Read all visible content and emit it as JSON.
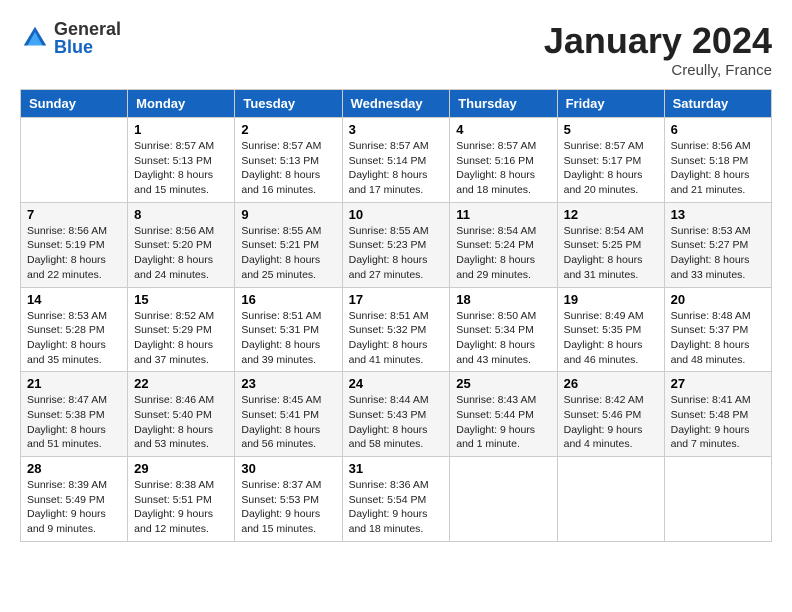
{
  "logo": {
    "general": "General",
    "blue": "Blue"
  },
  "title": "January 2024",
  "location": "Creully, France",
  "days_of_week": [
    "Sunday",
    "Monday",
    "Tuesday",
    "Wednesday",
    "Thursday",
    "Friday",
    "Saturday"
  ],
  "weeks": [
    [
      {
        "day": "",
        "sunrise": "",
        "sunset": "",
        "daylight": ""
      },
      {
        "day": "1",
        "sunrise": "Sunrise: 8:57 AM",
        "sunset": "Sunset: 5:13 PM",
        "daylight": "Daylight: 8 hours and 15 minutes."
      },
      {
        "day": "2",
        "sunrise": "Sunrise: 8:57 AM",
        "sunset": "Sunset: 5:13 PM",
        "daylight": "Daylight: 8 hours and 16 minutes."
      },
      {
        "day": "3",
        "sunrise": "Sunrise: 8:57 AM",
        "sunset": "Sunset: 5:14 PM",
        "daylight": "Daylight: 8 hours and 17 minutes."
      },
      {
        "day": "4",
        "sunrise": "Sunrise: 8:57 AM",
        "sunset": "Sunset: 5:16 PM",
        "daylight": "Daylight: 8 hours and 18 minutes."
      },
      {
        "day": "5",
        "sunrise": "Sunrise: 8:57 AM",
        "sunset": "Sunset: 5:17 PM",
        "daylight": "Daylight: 8 hours and 20 minutes."
      },
      {
        "day": "6",
        "sunrise": "Sunrise: 8:56 AM",
        "sunset": "Sunset: 5:18 PM",
        "daylight": "Daylight: 8 hours and 21 minutes."
      }
    ],
    [
      {
        "day": "7",
        "sunrise": "Sunrise: 8:56 AM",
        "sunset": "Sunset: 5:19 PM",
        "daylight": "Daylight: 8 hours and 22 minutes."
      },
      {
        "day": "8",
        "sunrise": "Sunrise: 8:56 AM",
        "sunset": "Sunset: 5:20 PM",
        "daylight": "Daylight: 8 hours and 24 minutes."
      },
      {
        "day": "9",
        "sunrise": "Sunrise: 8:55 AM",
        "sunset": "Sunset: 5:21 PM",
        "daylight": "Daylight: 8 hours and 25 minutes."
      },
      {
        "day": "10",
        "sunrise": "Sunrise: 8:55 AM",
        "sunset": "Sunset: 5:23 PM",
        "daylight": "Daylight: 8 hours and 27 minutes."
      },
      {
        "day": "11",
        "sunrise": "Sunrise: 8:54 AM",
        "sunset": "Sunset: 5:24 PM",
        "daylight": "Daylight: 8 hours and 29 minutes."
      },
      {
        "day": "12",
        "sunrise": "Sunrise: 8:54 AM",
        "sunset": "Sunset: 5:25 PM",
        "daylight": "Daylight: 8 hours and 31 minutes."
      },
      {
        "day": "13",
        "sunrise": "Sunrise: 8:53 AM",
        "sunset": "Sunset: 5:27 PM",
        "daylight": "Daylight: 8 hours and 33 minutes."
      }
    ],
    [
      {
        "day": "14",
        "sunrise": "Sunrise: 8:53 AM",
        "sunset": "Sunset: 5:28 PM",
        "daylight": "Daylight: 8 hours and 35 minutes."
      },
      {
        "day": "15",
        "sunrise": "Sunrise: 8:52 AM",
        "sunset": "Sunset: 5:29 PM",
        "daylight": "Daylight: 8 hours and 37 minutes."
      },
      {
        "day": "16",
        "sunrise": "Sunrise: 8:51 AM",
        "sunset": "Sunset: 5:31 PM",
        "daylight": "Daylight: 8 hours and 39 minutes."
      },
      {
        "day": "17",
        "sunrise": "Sunrise: 8:51 AM",
        "sunset": "Sunset: 5:32 PM",
        "daylight": "Daylight: 8 hours and 41 minutes."
      },
      {
        "day": "18",
        "sunrise": "Sunrise: 8:50 AM",
        "sunset": "Sunset: 5:34 PM",
        "daylight": "Daylight: 8 hours and 43 minutes."
      },
      {
        "day": "19",
        "sunrise": "Sunrise: 8:49 AM",
        "sunset": "Sunset: 5:35 PM",
        "daylight": "Daylight: 8 hours and 46 minutes."
      },
      {
        "day": "20",
        "sunrise": "Sunrise: 8:48 AM",
        "sunset": "Sunset: 5:37 PM",
        "daylight": "Daylight: 8 hours and 48 minutes."
      }
    ],
    [
      {
        "day": "21",
        "sunrise": "Sunrise: 8:47 AM",
        "sunset": "Sunset: 5:38 PM",
        "daylight": "Daylight: 8 hours and 51 minutes."
      },
      {
        "day": "22",
        "sunrise": "Sunrise: 8:46 AM",
        "sunset": "Sunset: 5:40 PM",
        "daylight": "Daylight: 8 hours and 53 minutes."
      },
      {
        "day": "23",
        "sunrise": "Sunrise: 8:45 AM",
        "sunset": "Sunset: 5:41 PM",
        "daylight": "Daylight: 8 hours and 56 minutes."
      },
      {
        "day": "24",
        "sunrise": "Sunrise: 8:44 AM",
        "sunset": "Sunset: 5:43 PM",
        "daylight": "Daylight: 8 hours and 58 minutes."
      },
      {
        "day": "25",
        "sunrise": "Sunrise: 8:43 AM",
        "sunset": "Sunset: 5:44 PM",
        "daylight": "Daylight: 9 hours and 1 minute."
      },
      {
        "day": "26",
        "sunrise": "Sunrise: 8:42 AM",
        "sunset": "Sunset: 5:46 PM",
        "daylight": "Daylight: 9 hours and 4 minutes."
      },
      {
        "day": "27",
        "sunrise": "Sunrise: 8:41 AM",
        "sunset": "Sunset: 5:48 PM",
        "daylight": "Daylight: 9 hours and 7 minutes."
      }
    ],
    [
      {
        "day": "28",
        "sunrise": "Sunrise: 8:39 AM",
        "sunset": "Sunset: 5:49 PM",
        "daylight": "Daylight: 9 hours and 9 minutes."
      },
      {
        "day": "29",
        "sunrise": "Sunrise: 8:38 AM",
        "sunset": "Sunset: 5:51 PM",
        "daylight": "Daylight: 9 hours and 12 minutes."
      },
      {
        "day": "30",
        "sunrise": "Sunrise: 8:37 AM",
        "sunset": "Sunset: 5:53 PM",
        "daylight": "Daylight: 9 hours and 15 minutes."
      },
      {
        "day": "31",
        "sunrise": "Sunrise: 8:36 AM",
        "sunset": "Sunset: 5:54 PM",
        "daylight": "Daylight: 9 hours and 18 minutes."
      },
      {
        "day": "",
        "sunrise": "",
        "sunset": "",
        "daylight": ""
      },
      {
        "day": "",
        "sunrise": "",
        "sunset": "",
        "daylight": ""
      },
      {
        "day": "",
        "sunrise": "",
        "sunset": "",
        "daylight": ""
      }
    ]
  ]
}
